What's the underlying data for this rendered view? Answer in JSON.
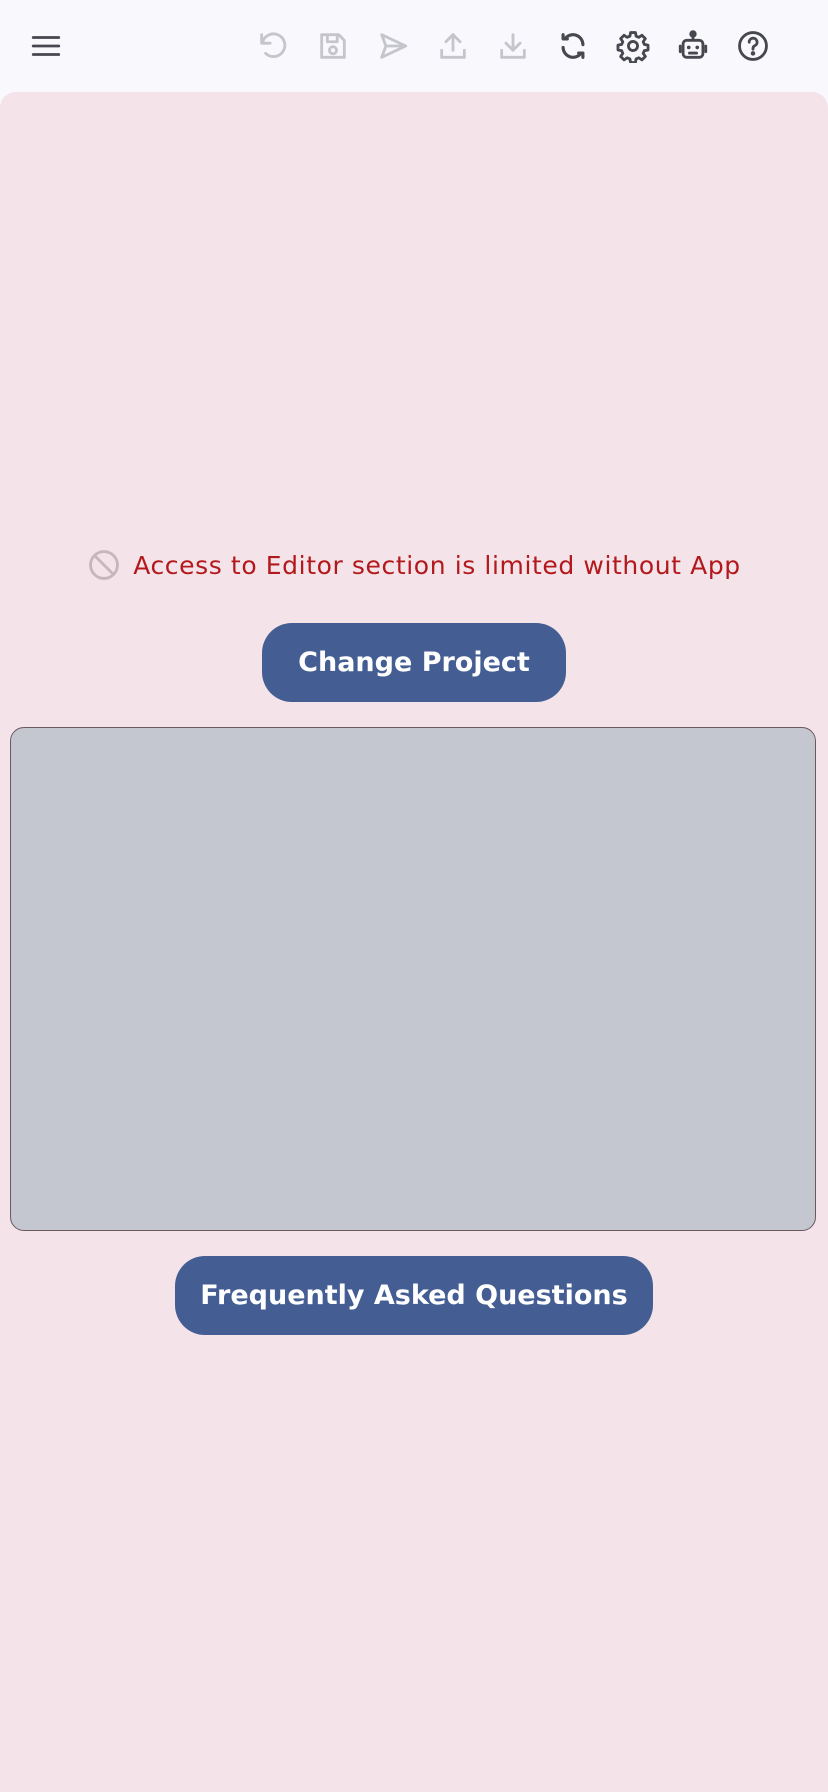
{
  "toolbar": {
    "icons": [
      {
        "name": "menu-icon",
        "enabled": true
      },
      {
        "name": "undo-icon",
        "enabled": false
      },
      {
        "name": "save-icon",
        "enabled": false
      },
      {
        "name": "send-icon",
        "enabled": false
      },
      {
        "name": "upload-icon",
        "enabled": false
      },
      {
        "name": "download-icon",
        "enabled": false
      },
      {
        "name": "sync-icon",
        "enabled": true
      },
      {
        "name": "gear-icon",
        "enabled": true
      },
      {
        "name": "robot-icon",
        "enabled": true
      },
      {
        "name": "help-icon",
        "enabled": true
      }
    ]
  },
  "notice": {
    "icon": "block-icon",
    "text": "Access to Editor section is limited without App"
  },
  "buttons": {
    "change_project": "Change Project",
    "faq": "Frequently Asked Questions"
  },
  "colors": {
    "toolbar_bg": "#f9f8fd",
    "panel_bg": "#f4e3e8",
    "preview_bg": "#c4c6d0",
    "button_bg": "#445e93",
    "button_text": "#ffffff",
    "warning_text": "#b3191c",
    "icon_enabled": "#46474f",
    "icon_disabled": "#c5c5cc"
  }
}
